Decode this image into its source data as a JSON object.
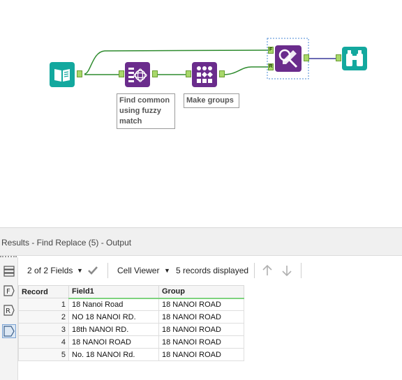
{
  "workflow": {
    "input_tool_icon": "book-icon",
    "fuzzy_tool": {
      "icon": "fuzzy-match-icon",
      "label": "Find common using fuzzy match"
    },
    "groups_tool": {
      "icon": "make-group-icon",
      "label": "Make groups"
    },
    "find_replace_tool": {
      "icon": "find-replace-icon",
      "anchor_f": "F",
      "anchor_r": "R"
    },
    "browse_tool_icon": "binoculars-icon"
  },
  "results": {
    "title": "Results - Find Replace (5) - Output",
    "fields_selector": "2 of 2 Fields",
    "viewer_selector": "Cell Viewer",
    "records_displayed": "5 records displayed",
    "columns": [
      "Record",
      "Field1",
      "Group"
    ],
    "rows": [
      {
        "record": "1",
        "field1": "18 Nanoi Road",
        "group": "18 NANOI ROAD"
      },
      {
        "record": "2",
        "field1": "NO 18 NANOI RD.",
        "group": "18 NANOI ROAD"
      },
      {
        "record": "3",
        "field1": "18th NANOI RD.",
        "group": "18 NANOI ROAD"
      },
      {
        "record": "4",
        "field1": "18 NANOI ROAD",
        "group": "18 NANOI ROAD"
      },
      {
        "record": "5",
        "field1": "No. 18 NANOI Rd.",
        "group": "18 NANOI ROAD"
      }
    ],
    "sidebar": [
      "table-icon",
      "field-icon",
      "record-icon",
      "tag-icon"
    ]
  },
  "colors": {
    "teal": "#13a89e",
    "purple": "#6a2c8c",
    "wire_green": "#2e8b2e",
    "wire_blue": "#3a3a9a",
    "anchor_green": "#a8d86a"
  }
}
